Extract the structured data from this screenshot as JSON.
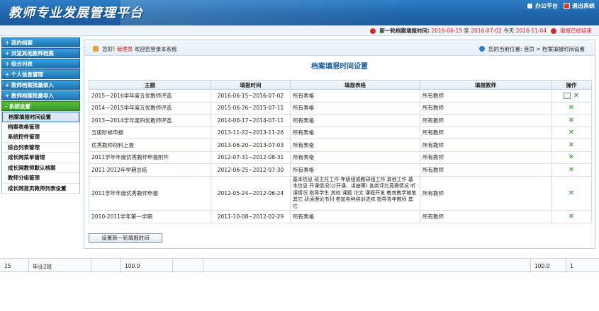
{
  "app": {
    "title": "教师专业发展管理平台",
    "office_label": "办公平台",
    "logout_label": "退出系统"
  },
  "notice": {
    "label": "新一轮档案填报时间:",
    "start": "2016-06-15",
    "to": "至",
    "end": "2016-07-02",
    "today_label": "今天",
    "today": "2016-11-04",
    "status": "填报已经结束"
  },
  "sidebar": {
    "menus": [
      {
        "label": "+ 我的档案"
      },
      {
        "label": "+ 浏览其他教师档案"
      },
      {
        "label": "+ 综合列表"
      },
      {
        "label": "+ 个人信息管理"
      },
      {
        "label": "+ 教师档案批量录入"
      },
      {
        "label": "+ 教师档案批量导入"
      },
      {
        "label": "- 系统设置"
      }
    ],
    "subitems": [
      {
        "label": "档案填报时间设置"
      },
      {
        "label": "档案表格管理"
      },
      {
        "label": "系统控件管理"
      },
      {
        "label": "综合列表管理"
      },
      {
        "label": "成长网菜单管理"
      },
      {
        "label": "成长网教师默认档案"
      },
      {
        "label": "教师分组管理"
      },
      {
        "label": "成长网首页教师列表设置"
      }
    ]
  },
  "main": {
    "welcome_prefix": "您好!",
    "user": "管理员",
    "welcome_suffix": "欢迎您登录本系统",
    "location_prefix": "您的当前位置:",
    "location": "首页 > 档案填报时间设置",
    "page_title": "档案填报时间设置",
    "columns": {
      "topic": "主题",
      "time": "填报时间",
      "form": "填报表格",
      "teacher": "填报教师",
      "action": "操作"
    },
    "rows": [
      {
        "topic": "2015—2016学年度五优教师评选",
        "time": "2016-06-15~2016-07-02",
        "form": "所有表格",
        "teacher": "所有教师"
      },
      {
        "topic": "2014—2015学年度五优教师评选",
        "time": "2015-06-26~2015-07-11",
        "form": "所有表格",
        "teacher": "所有教师"
      },
      {
        "topic": "2013—2014学年度四优教师评选",
        "time": "2014-06-17~2014-07-11",
        "form": "所有表格",
        "teacher": "所有教师"
      },
      {
        "topic": "五级阶梯申报",
        "time": "2013-11-22~2013-11-26",
        "form": "所有表格",
        "teacher": "所有教师"
      },
      {
        "topic": "优秀教师材料上报",
        "time": "2013-06-20~2013-07-03",
        "form": "所有表格",
        "teacher": "所有教师"
      },
      {
        "topic": "2011学年年度优秀教师申报附件",
        "time": "2012-07-31~2012-08-31",
        "form": "所有表格",
        "teacher": "所有教师"
      },
      {
        "topic": "2011-2012年学期总结",
        "time": "2012-06-25~2012-07-30",
        "form": "所有表格",
        "teacher": "所有教师"
      },
      {
        "topic": "2011学年年度优秀教师申报",
        "time": "2012-05-24~2012-06-24",
        "form": "基本信息 班主任工作 年级组或教研组工作 其他工作 基本信息 开课情况(公开课、讲座等) 各类评比竞赛情况 听课情况 指导学生 其他 课题 论文 课程开发 教育教学随笔 其它 研读理论书刊 参加各种培训进修 指导青年教师 其它",
        "teacher": "所有教师"
      },
      {
        "topic": "2010-2011学年第一学期",
        "time": "2011-10-08~2012-02-29",
        "form": "所有表格",
        "teacher": "所有教师"
      }
    ],
    "new_button": "设置新一轮填报时间"
  },
  "bottom_row": {
    "no": "15",
    "class": "毕业2班",
    "score1": "100.0",
    "score2": "100.0",
    "rank": "1"
  }
}
